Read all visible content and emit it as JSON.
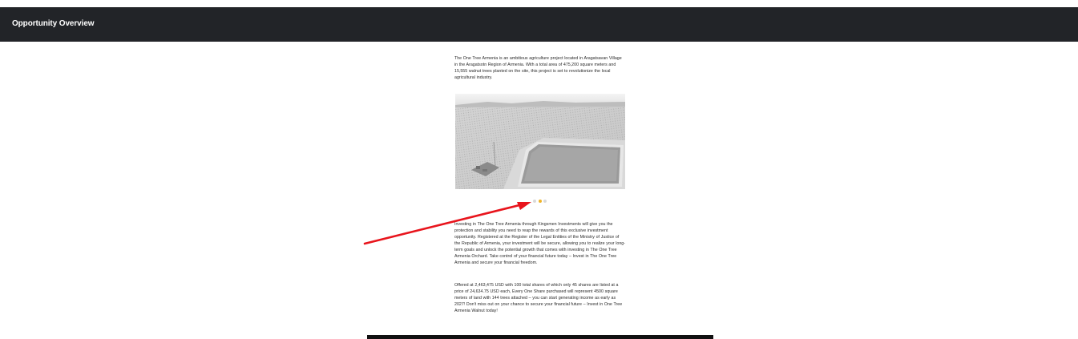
{
  "header": {
    "title": "Opportunity Overview"
  },
  "main": {
    "intro_text": "The One Tree Armenia is an ambitious agriculture project located in Aragatsavan Village in the Aragatsotn Region of Armenia. With a total area of 475,200 square meters and 15,555 walnut trees planted on the site, this project is set to revolutionize the local agricultural industry.",
    "image_alt": "Aerial view of orchard land with water reservoir",
    "carousel": {
      "slide_count": 3,
      "active_index": 1,
      "colors": {
        "active": "#f0b428",
        "inactive": "#d9d9d9"
      }
    },
    "invest_text": "Investing in The One Tree Armenia through Kingsmen Investments will give you the protection and stability you need to reap the rewards of this exclusive investment opportunity. Registered at the Register of the Legal Entities of the Ministry of Justice of the Republic of Armenia, your investment will be secure, allowing you to realize your long-term goals and unlock the potential growth that comes with investing in The One Tree Armenia Orchard. Take control of your financial future today – Invest in The One Tree Armenia and secure your financial freedom.",
    "offer_text": "Offered at 2,463,475 USD with 100 total shares of which only 45 shares are listed at a price of 24,634.75 USD each, Every One Share purchased will represent 4500 square meters of land with 144 trees attached – you can start generating income as early as 2027! Don't miss out on your chance to secure your financial future – Invest in One Tree Armenia Walnut today!"
  },
  "annotation": {
    "arrow_color": "#e8141c"
  },
  "colors": {
    "header_bg": "#222428",
    "header_text": "#ffffff",
    "body_text": "#2a2a2a",
    "bottom_bar": "#111111"
  }
}
